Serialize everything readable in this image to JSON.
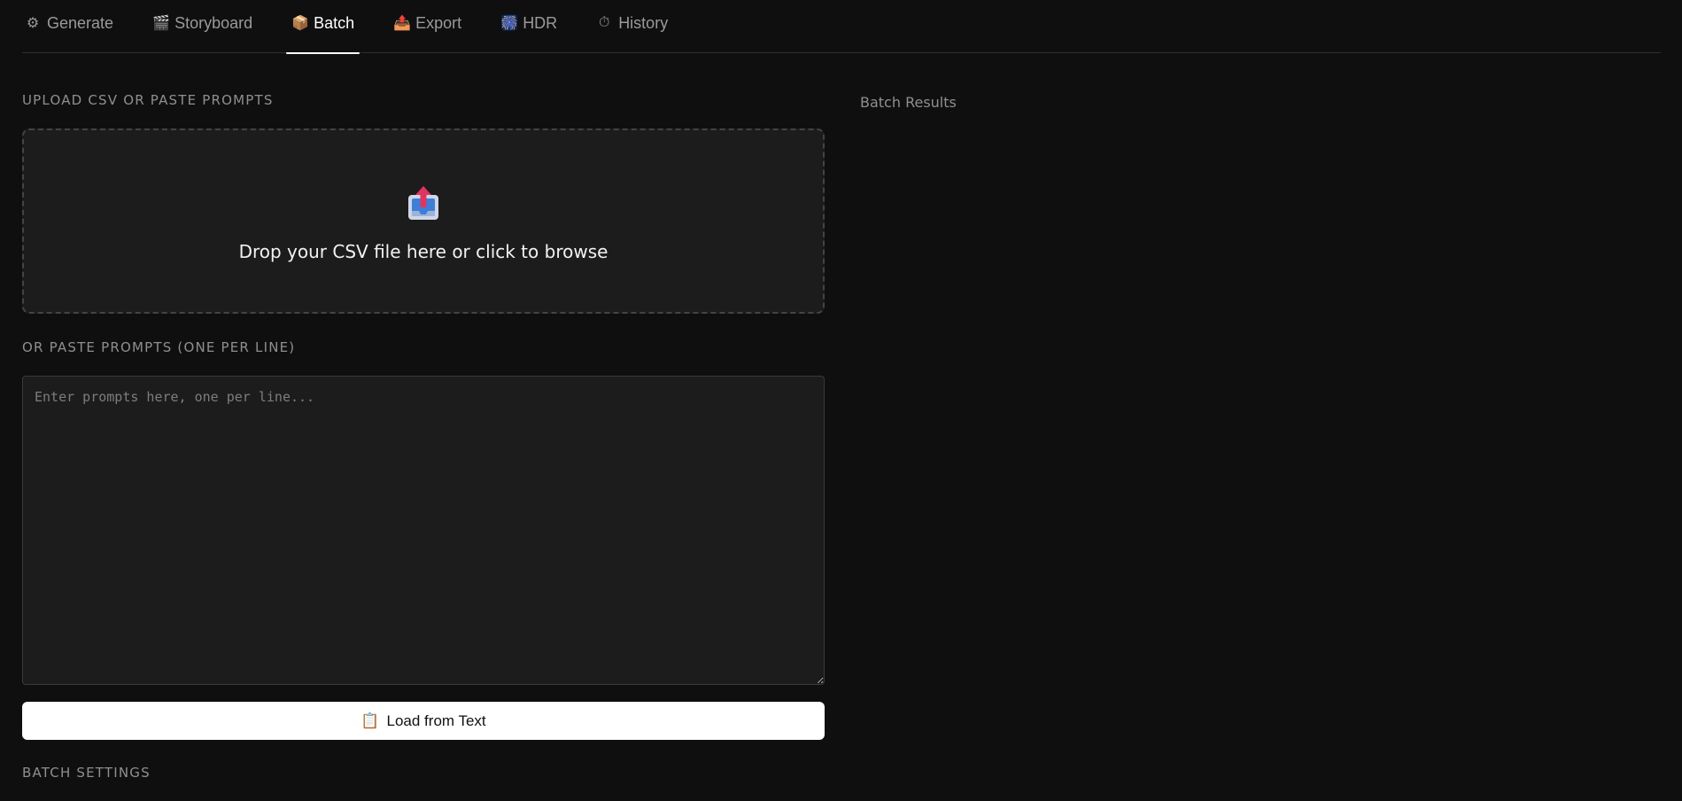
{
  "tabs": [
    {
      "label": "Generate",
      "icon": "gear-icon",
      "glyph": "⚙",
      "active": false
    },
    {
      "label": "Storyboard",
      "icon": "clapperboard-icon",
      "glyph": "🎬",
      "active": false
    },
    {
      "label": "Batch",
      "icon": "package-icon",
      "glyph": "📦",
      "active": true
    },
    {
      "label": "Export",
      "icon": "outbox-tray-icon",
      "glyph": "📤",
      "active": false
    },
    {
      "label": "HDR",
      "icon": "fireworks-icon",
      "glyph": "🎆",
      "active": false
    },
    {
      "label": "History",
      "icon": "stopwatch-icon",
      "glyph": "⏱",
      "active": false
    }
  ],
  "upload": {
    "section_label": "UPLOAD CSV OR PASTE PROMPTS",
    "dropzone_icon": "upload-tray-icon",
    "dropzone_text": "Drop your CSV file here or click to browse"
  },
  "paste": {
    "section_label": "OR PASTE PROMPTS (ONE PER LINE)",
    "placeholder": "Enter prompts here, one per line...",
    "value": ""
  },
  "load_button": {
    "label": "Load from Text",
    "icon": "clipboard-icon",
    "glyph": "📋"
  },
  "batch_settings": {
    "section_label": "BATCH SETTINGS"
  },
  "results": {
    "title": "Batch Results"
  },
  "colors": {
    "background": "#0f0f0f",
    "panel": "#1c1c1c",
    "accent": "#ffffff",
    "muted_text": "#8f8f8f"
  }
}
